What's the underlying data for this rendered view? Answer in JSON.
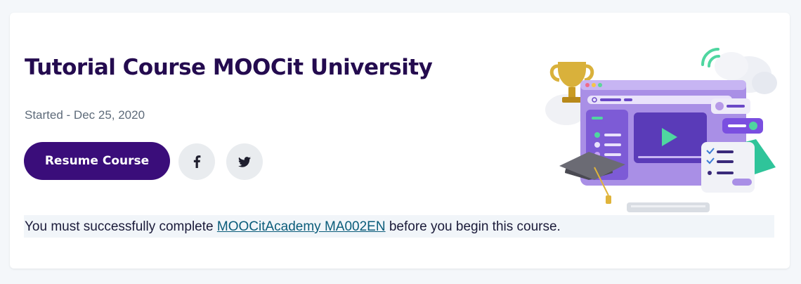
{
  "course": {
    "title": "Tutorial Course MOOCit University",
    "started": "Started - Dec 25, 2020",
    "resume_label": "Resume Course"
  },
  "social": {
    "facebook_icon": "facebook-icon",
    "twitter_icon": "twitter-icon"
  },
  "prerequisite": {
    "before": "You must successfully complete ",
    "link_text": "MOOCitAcademy MA002EN",
    "after": " before you begin this course."
  },
  "colors": {
    "title": "#240b4f",
    "button": "#3a0d7a",
    "link": "#0a5c7a",
    "background": "#f4f7fa"
  }
}
